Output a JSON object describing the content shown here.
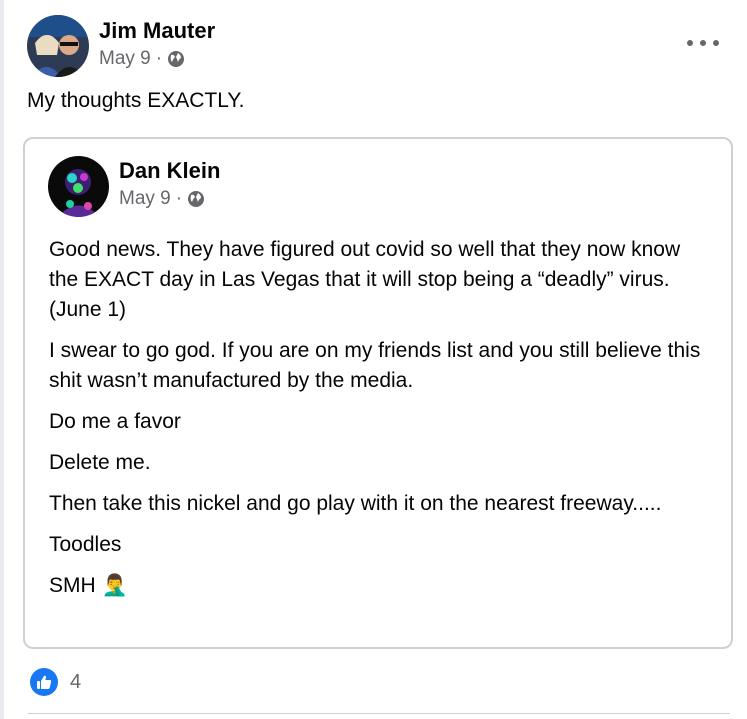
{
  "post": {
    "author": "Jim Mauter",
    "date": "May 9",
    "separator": "·",
    "text": "My thoughts EXACTLY."
  },
  "shared_post": {
    "author": "Dan Klein",
    "date": "May 9",
    "separator": "·",
    "paragraphs": [
      "Good news.  They have figured out covid so well that they now know the EXACT day in Las Vegas that it will stop being a “deadly” virus. (June 1)",
      "I swear to go god.  If you are on my friends list and you still believe this shit wasn’t manufactured by the media.",
      "Do me a favor",
      "Delete me.",
      "Then take this nickel and go play with it  on the nearest freeway.....",
      "Toodles",
      "SMH 🤦‍♂️"
    ]
  },
  "reactions": {
    "count": "4",
    "icon": "like-icon",
    "color": "#1877f2"
  },
  "icons": {
    "privacy": "globe-icon",
    "menu": "more-options-icon"
  }
}
